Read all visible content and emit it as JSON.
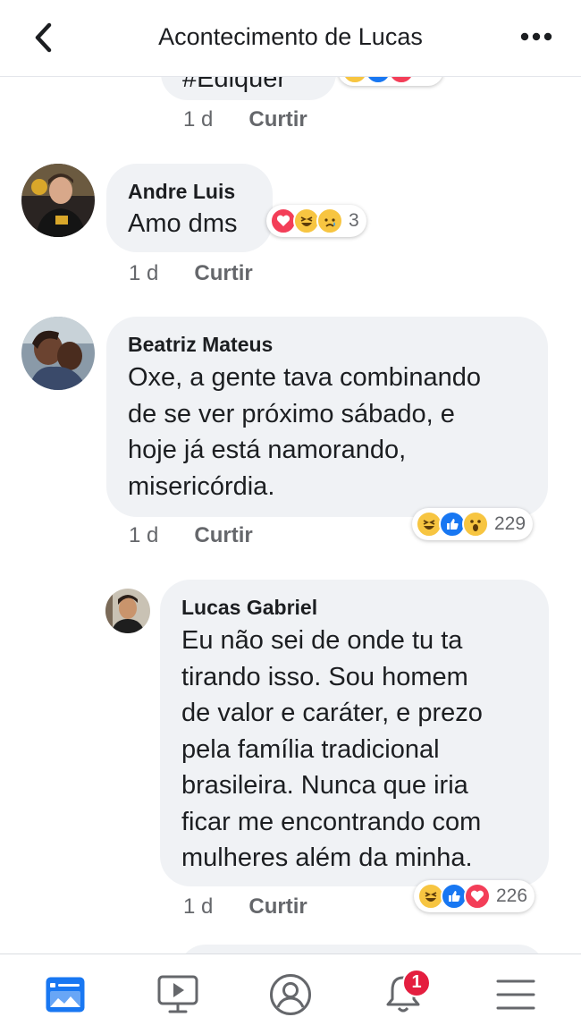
{
  "header": {
    "title": "Acontecimento de Lucas",
    "back_icon": "back-arrow-icon",
    "more_icon": "more-dots-icon"
  },
  "partial_top": {
    "text": "#Ediquer",
    "time": "1 d",
    "like_label": "Curtir"
  },
  "comments": [
    {
      "author": "Andre Luis",
      "text": "Amo dms",
      "time": "1 d",
      "like_label": "Curtir",
      "reactions": [
        "love",
        "haha",
        "sad"
      ],
      "reaction_count": "3"
    },
    {
      "author": "Beatriz Mateus",
      "text": "Oxe, a gente tava combinando\nde se ver próximo sábado, e\nhoje já está namorando,\nmisericórdia.",
      "time": "1 d",
      "like_label": "Curtir",
      "reactions": [
        "haha",
        "like",
        "wow"
      ],
      "reaction_count": "229"
    },
    {
      "author": "Lucas Gabriel",
      "text": "Eu não sei de onde tu ta\ntirando isso. Sou homem\nde valor e caráter, e prezo\npela família tradicional\nbrasileira. Nunca que iria\nficar me encontrando com\nmulheres além da minha.",
      "time": "1 d",
      "like_label": "Curtir",
      "reactions": [
        "haha",
        "like",
        "love"
      ],
      "reaction_count": "226"
    }
  ],
  "bottom_nav": {
    "items": [
      "news-feed-icon",
      "watch-icon",
      "profile-icon",
      "notifications-icon",
      "menu-icon"
    ],
    "notification_badge": "1"
  },
  "colors": {
    "bubble": "#f0f2f5",
    "meta_text": "#65676b",
    "accent_blue": "#1877f2",
    "badge_red": "#e41e3f",
    "love_red": "#f33e58",
    "haha_yellow": "#f7c541"
  }
}
